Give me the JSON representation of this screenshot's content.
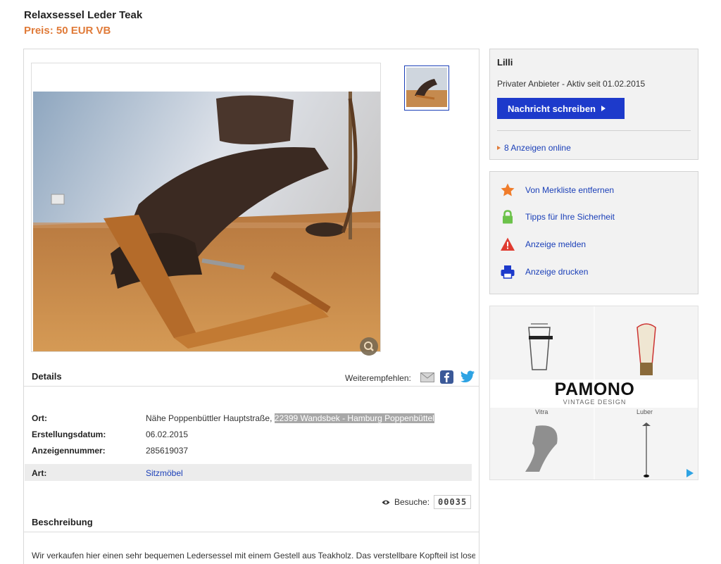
{
  "listing": {
    "title": "Relaxsessel Leder Teak",
    "price": "Preis: 50 EUR VB"
  },
  "share": {
    "label": "Weiterempfehlen:"
  },
  "details": {
    "heading": "Details",
    "rows": [
      {
        "label": "Ort:",
        "value": "Nähe Poppenbüttler Hauptstraße,",
        "value_highlight": "22399 Wandsbek - Hamburg Poppenbüttel"
      },
      {
        "label": "Erstellungsdatum:",
        "value": "06.02.2015"
      },
      {
        "label": "Anzeigennummer:",
        "value": "285619037"
      },
      {
        "label": "Art:",
        "value": "Sitzmöbel"
      }
    ]
  },
  "visits": {
    "label": "Besuche:",
    "count": "00035"
  },
  "description": {
    "heading": "Beschreibung",
    "text": "Wir verkaufen hier einen sehr bequemen Ledersessel mit einem Gestell aus Teakholz. Das verstellbare Kopfteil ist lose,"
  },
  "seller": {
    "name": "Lilli",
    "meta": "Privater Anbieter - Aktiv seit 01.02.2015",
    "message_button": "Nachricht schreiben",
    "ads_online": "8 Anzeigen online"
  },
  "actions": [
    {
      "label": "Von Merkliste entfernen",
      "icon": "star-icon",
      "color": "#f07c2a"
    },
    {
      "label": "Tipps für Ihre Sicherheit",
      "icon": "lock-icon",
      "color": "#6cc24a"
    },
    {
      "label": "Anzeige melden",
      "icon": "warning-icon",
      "color": "#e03c31"
    },
    {
      "label": "Anzeige drucken",
      "icon": "printer-icon",
      "color": "#1d3acb"
    }
  ],
  "ad": {
    "brand": "PAMONO",
    "sub": "VINTAGE DESIGN",
    "captions": [
      "Vitra",
      "Luber"
    ]
  },
  "colors": {
    "accent": "#e07b39",
    "primary": "#1d3acb",
    "link": "#1a3fb8"
  }
}
